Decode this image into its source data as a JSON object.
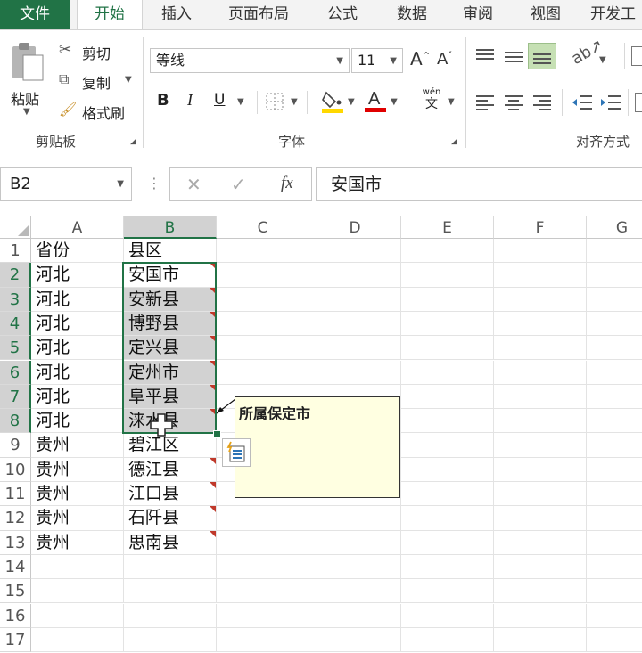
{
  "tabs": {
    "file": "文件",
    "items": [
      "开始",
      "插入",
      "页面布局",
      "公式",
      "数据",
      "审阅",
      "视图",
      "开发工"
    ]
  },
  "clipboard": {
    "paste": "粘贴",
    "cut": "剪切",
    "copy": "复制",
    "format_painter": "格式刷",
    "group": "剪贴板"
  },
  "font": {
    "name": "等线",
    "size": "11",
    "bold": "B",
    "italic": "I",
    "underline": "U",
    "phonetic_top": "wén",
    "phonetic_bottom": "文",
    "group": "字体"
  },
  "alignment": {
    "group": "对齐方式"
  },
  "formula_bar": {
    "name_box": "B2",
    "fx": "fx",
    "value": "安国市"
  },
  "grid": {
    "columns": [
      "A",
      "B",
      "C",
      "D",
      "E",
      "F",
      "G"
    ],
    "rows": [
      {
        "n": "1",
        "a": "省份",
        "b": "县区",
        "note": false
      },
      {
        "n": "2",
        "a": "河北",
        "b": "安国市",
        "note": true
      },
      {
        "n": "3",
        "a": "河北",
        "b": "安新县",
        "note": true
      },
      {
        "n": "4",
        "a": "河北",
        "b": "博野县",
        "note": true
      },
      {
        "n": "5",
        "a": "河北",
        "b": "定兴县",
        "note": true
      },
      {
        "n": "6",
        "a": "河北",
        "b": "定州市",
        "note": true
      },
      {
        "n": "7",
        "a": "河北",
        "b": "阜平县",
        "note": true
      },
      {
        "n": "8",
        "a": "河北",
        "b": "涞水县",
        "note": true
      },
      {
        "n": "9",
        "a": "贵州",
        "b": "碧江区",
        "note": false
      },
      {
        "n": "10",
        "a": "贵州",
        "b": "德江县",
        "note": true
      },
      {
        "n": "11",
        "a": "贵州",
        "b": "江口县",
        "note": true
      },
      {
        "n": "12",
        "a": "贵州",
        "b": "石阡县",
        "note": true
      },
      {
        "n": "13",
        "a": "贵州",
        "b": "思南县",
        "note": true
      },
      {
        "n": "14",
        "a": "",
        "b": "",
        "note": false
      },
      {
        "n": "15",
        "a": "",
        "b": "",
        "note": false
      },
      {
        "n": "16",
        "a": "",
        "b": "",
        "note": false
      },
      {
        "n": "17",
        "a": "",
        "b": "",
        "note": false
      }
    ]
  },
  "comment": {
    "text": "所属保定市"
  },
  "colors": {
    "accent": "#217346",
    "selection": "#d2d2d2",
    "note_marker": "#c0392b",
    "comment_bg": "#ffffe1"
  }
}
